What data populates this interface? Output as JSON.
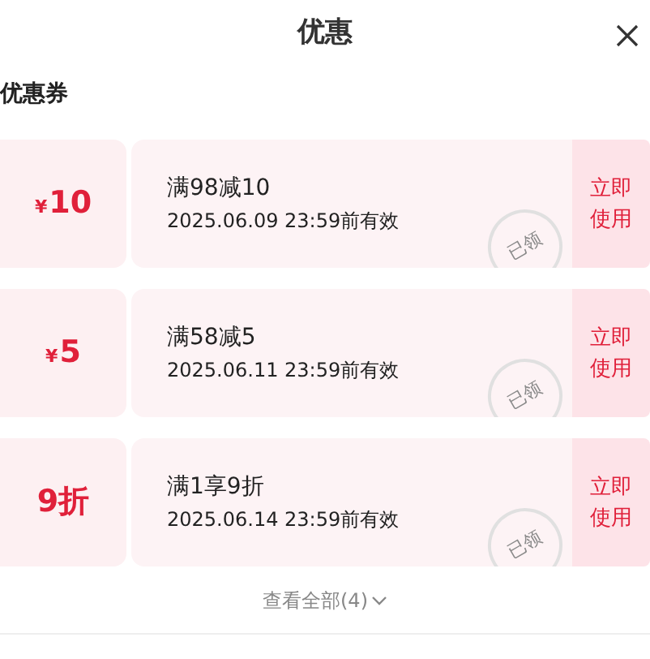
{
  "header": {
    "title": "优惠"
  },
  "section": {
    "title": "优惠券"
  },
  "coupons": [
    {
      "currency": "¥",
      "amount": "10",
      "condition": "满98减10",
      "validity": "2025.06.09 23:59前有效",
      "stamp": "已领",
      "action": "立即使用"
    },
    {
      "currency": "¥",
      "amount": "5",
      "condition": "满58减5",
      "validity": "2025.06.11 23:59前有效",
      "stamp": "已领",
      "action": "立即使用"
    },
    {
      "amount": "9折",
      "condition": "满1享9折",
      "validity": "2025.06.14 23:59前有效",
      "stamp": "已领",
      "action": "立即使用"
    }
  ],
  "footer": {
    "view_all": "查看全部(4)"
  }
}
